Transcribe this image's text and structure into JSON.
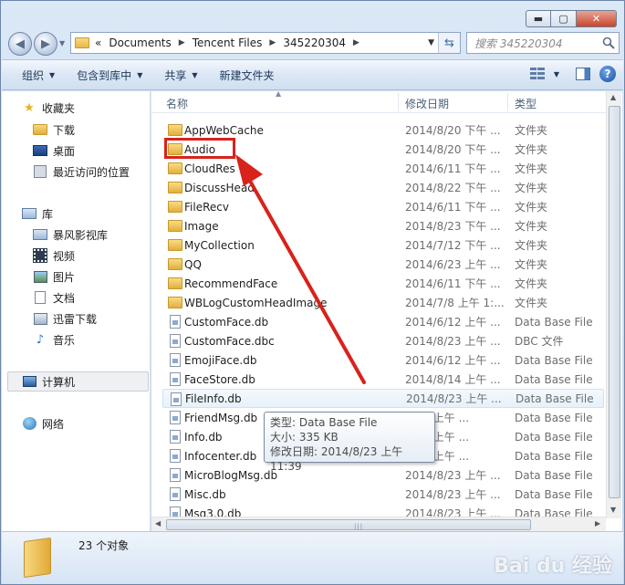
{
  "window": {
    "caption": {
      "minimize": "▬",
      "maximize": "▢",
      "close": "✕"
    }
  },
  "address": {
    "chevron": "«",
    "crumbs": [
      "Documents",
      "Tencent Files",
      "345220304"
    ]
  },
  "search": {
    "placeholder": "搜索 345220304"
  },
  "toolbar": {
    "organize": "组织",
    "include_in_library": "包含到库中",
    "share": "共享",
    "new_folder": "新建文件夹"
  },
  "nav": {
    "favorites": "收藏夹",
    "downloads": "下载",
    "desktop": "桌面",
    "recent": "最近访问的位置",
    "libraries": "库",
    "storm_video": "暴风影视库",
    "video": "视频",
    "pictures": "图片",
    "documents": "文档",
    "xunlei": "迅雷下载",
    "music": "音乐",
    "computer": "计算机",
    "network": "网络"
  },
  "columns": {
    "name": "名称",
    "date": "修改日期",
    "type": "类型"
  },
  "files": [
    {
      "name": "AppWebCache",
      "date": "2014/8/20 下午 ...",
      "type": "文件夹",
      "kind": "folder"
    },
    {
      "name": "Audio",
      "date": "2014/8/20 下午 ...",
      "type": "文件夹",
      "kind": "folder"
    },
    {
      "name": "CloudRes",
      "date": "2014/6/11 下午 ...",
      "type": "文件夹",
      "kind": "folder"
    },
    {
      "name": "DiscussHead",
      "date": "2014/8/22 下午 ...",
      "type": "文件夹",
      "kind": "folder"
    },
    {
      "name": "FileRecv",
      "date": "2014/6/11 下午 ...",
      "type": "文件夹",
      "kind": "folder"
    },
    {
      "name": "Image",
      "date": "2014/8/23 下午 ...",
      "type": "文件夹",
      "kind": "folder"
    },
    {
      "name": "MyCollection",
      "date": "2014/7/12 下午 ...",
      "type": "文件夹",
      "kind": "folder"
    },
    {
      "name": "QQ",
      "date": "2014/6/23 上午 ...",
      "type": "文件夹",
      "kind": "folder"
    },
    {
      "name": "RecommendFace",
      "date": "2014/6/11 下午 ...",
      "type": "文件夹",
      "kind": "folder"
    },
    {
      "name": "WBLogCustomHeadImage",
      "date": "2014/7/8 上午 1:...",
      "type": "文件夹",
      "kind": "folder"
    },
    {
      "name": "CustomFace.db",
      "date": "2014/6/12 上午 ...",
      "type": "Data Base File",
      "kind": "file"
    },
    {
      "name": "CustomFace.dbc",
      "date": "2014/8/23 上午 ...",
      "type": "DBC 文件",
      "kind": "file"
    },
    {
      "name": "EmojiFace.db",
      "date": "2014/6/12 上午 ...",
      "type": "Data Base File",
      "kind": "file"
    },
    {
      "name": "FaceStore.db",
      "date": "2014/8/14 上午 ...",
      "type": "Data Base File",
      "kind": "file"
    },
    {
      "name": "FileInfo.db",
      "date": "2014/8/23 上午 ...",
      "type": "Data Base File",
      "kind": "file"
    },
    {
      "name": "FriendMsg.db",
      "date": "8/23 上午 ...",
      "type": "Data Base File",
      "kind": "file"
    },
    {
      "name": "Info.db",
      "date": "8/23 上午 ...",
      "type": "Data Base File",
      "kind": "file"
    },
    {
      "name": "Infocenter.db",
      "date": "8/23 上午 ...",
      "type": "Data Base File",
      "kind": "file"
    },
    {
      "name": "MicroBlogMsg.db",
      "date": "2014/8/23 上午 ...",
      "type": "Data Base File",
      "kind": "file"
    },
    {
      "name": "Misc.db",
      "date": "2014/8/23 上午 ...",
      "type": "Data Base File",
      "kind": "file"
    },
    {
      "name": "Msg3.0.db",
      "date": "2014/8/23 上午 ...",
      "type": "Data Base File",
      "kind": "file"
    }
  ],
  "tooltip": {
    "type": "类型: Data Base File",
    "size": "大小: 335 KB",
    "modified": "修改日期: 2014/8/23 上午 11:39"
  },
  "details": {
    "count": "23 个对象"
  },
  "watermark": "Bai du 经验",
  "colors": {
    "highlight": "#d8221b",
    "window_frame": "#c3d6ee"
  }
}
